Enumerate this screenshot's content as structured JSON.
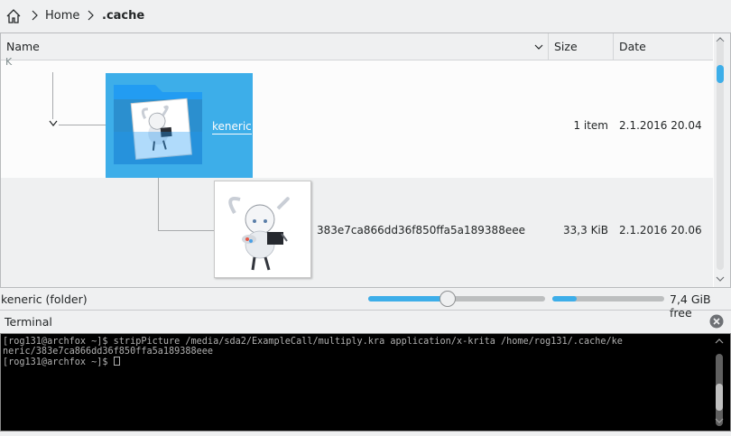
{
  "breadcrumb": {
    "home_icon": "home-icon",
    "items": [
      "Home",
      ".cache"
    ]
  },
  "columns": {
    "name": "Name",
    "size": "Size",
    "date": "Date"
  },
  "rows": [
    {
      "type": "folder",
      "name": "keneric",
      "size": "1 item",
      "date": "2.1.2016 20.04",
      "selected": true,
      "expanded": true
    },
    {
      "type": "file",
      "name": "383e7ca866dd36f850ffa5a189388eee",
      "size": "33,3 KiB",
      "date": "2.1.2016 20.06"
    }
  ],
  "partial_row_letter": "K",
  "status": {
    "selection_text": "keneric (folder)",
    "zoom_level": 0.45,
    "space_used_fraction": 0.22,
    "free_space_text": "7,4 GiB free"
  },
  "terminal": {
    "title": "Terminal",
    "lines": [
      "[rog131@archfox ~]$ stripPicture /media/sda2/ExampleCall/multiply.kra application/x-krita /home/rog131/.cache/ke",
      "neric/383e7ca866dd36f850ffa5a189388eee",
      "[rog131@archfox ~]$ "
    ]
  },
  "colors": {
    "accent": "#3daee9",
    "window_bg": "#eff0f1",
    "view_bg": "#fcfcfc",
    "text": "#232627",
    "terminal_bg": "#000000"
  }
}
